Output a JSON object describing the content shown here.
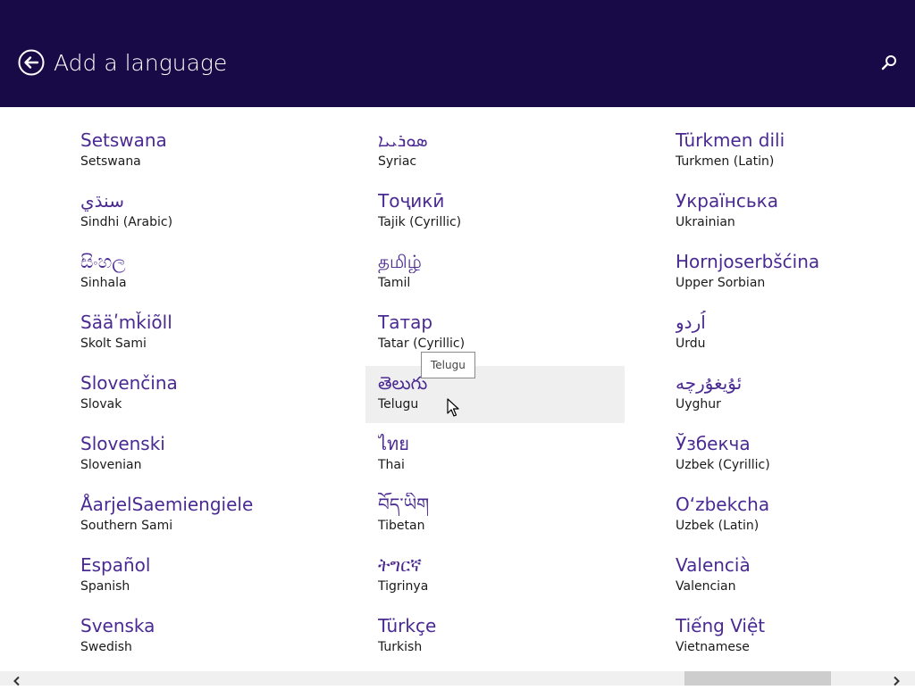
{
  "header": {
    "title": "Add a language",
    "back_icon": "back-arrow-icon",
    "search_icon": "search-icon",
    "background": "#180a46"
  },
  "columns": [
    [
      {
        "native": "Setswana",
        "english": "Setswana"
      },
      {
        "native": "سنڌي",
        "english": "Sindhi (Arabic)"
      },
      {
        "native": "සිංහල",
        "english": "Sinhala"
      },
      {
        "native": "Sääʹmǩiõll",
        "english": "Skolt Sami"
      },
      {
        "native": "Slovenčina",
        "english": "Slovak"
      },
      {
        "native": "Slovenski",
        "english": "Slovenian"
      },
      {
        "native": "ÅarjelSaemiengiele",
        "english": "Southern Sami"
      },
      {
        "native": "Español",
        "english": "Spanish"
      },
      {
        "native": "Svenska",
        "english": "Swedish"
      }
    ],
    [
      {
        "native": "ܣܘܪܝܝܐ",
        "english": "Syriac"
      },
      {
        "native": "Тоҷикӣ",
        "english": "Tajik (Cyrillic)"
      },
      {
        "native": "தமிழ்",
        "english": "Tamil"
      },
      {
        "native": "Татар",
        "english": "Tatar (Cyrillic)"
      },
      {
        "native": "తెలుగు",
        "english": "Telugu"
      },
      {
        "native": "ไทย",
        "english": "Thai"
      },
      {
        "native": "བོད་ཡིག",
        "english": "Tibetan"
      },
      {
        "native": "ትግርኛ",
        "english": "Tigrinya"
      },
      {
        "native": "Türkçe",
        "english": "Turkish"
      }
    ],
    [
      {
        "native": "Türkmen dili",
        "english": "Turkmen (Latin)"
      },
      {
        "native": "Українська",
        "english": "Ukrainian"
      },
      {
        "native": "Hornjoserbšćina",
        "english": "Upper Sorbian"
      },
      {
        "native": "اُردو",
        "english": "Urdu"
      },
      {
        "native": "ئۇيغۇرچە",
        "english": "Uyghur"
      },
      {
        "native": "Ўзбекча",
        "english": "Uzbek (Cyrillic)"
      },
      {
        "native": "O‘zbekcha",
        "english": "Uzbek (Latin)"
      },
      {
        "native": "Valencià",
        "english": "Valencian"
      },
      {
        "native": "Tiếng Việt",
        "english": "Vietnamese"
      }
    ]
  ],
  "tooltip": {
    "text": "Telugu"
  },
  "scrollbar": {
    "left_icon": "chevron-left-icon",
    "right_icon": "chevron-right-icon"
  },
  "colors": {
    "native_name": "#4a2a92",
    "hover_tile": "#efefef"
  }
}
